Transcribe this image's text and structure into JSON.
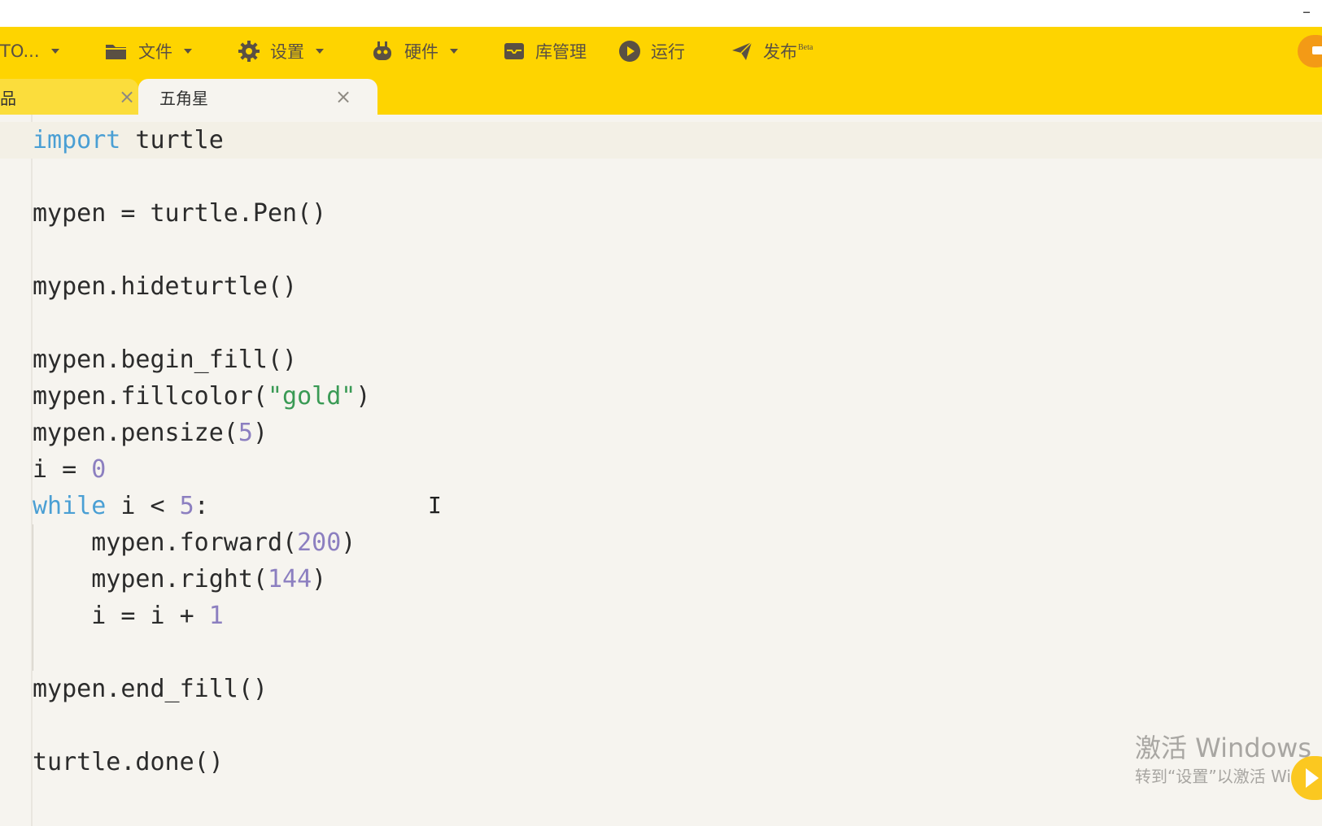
{
  "window": {
    "minimize_glyph": "–"
  },
  "toolbar": {
    "items": [
      {
        "label": "TO...",
        "icon": "none",
        "dropdown": true
      },
      {
        "label": "文件",
        "icon": "folder-icon",
        "dropdown": true
      },
      {
        "label": "设置",
        "icon": "gear-icon",
        "dropdown": true
      },
      {
        "label": "硬件",
        "icon": "robot-icon",
        "dropdown": true
      },
      {
        "label": "库管理",
        "icon": "inbox-icon",
        "dropdown": false
      },
      {
        "label": "运行",
        "icon": "play-icon",
        "dropdown": false
      },
      {
        "label": "发布",
        "badge": "Beta",
        "icon": "send-icon",
        "dropdown": false
      }
    ],
    "accent_color": "#fed400",
    "right_button_icon": "user-icon"
  },
  "tabs": [
    {
      "label": "品",
      "active": false,
      "close": "×"
    },
    {
      "label": "五角星",
      "active": true,
      "close": "×"
    }
  ],
  "editor": {
    "lines": [
      "import turtle",
      "",
      "mypen = turtle.Pen()",
      "",
      "mypen.hideturtle()",
      "",
      "mypen.begin_fill()",
      "mypen.fillcolor(\"gold\")",
      "mypen.pensize(5)",
      "i = 0",
      "while i < 5:",
      "    mypen.forward(200)",
      "    mypen.right(144)",
      "    i = i + 1",
      "",
      "mypen.end_fill()",
      "",
      "turtle.done()"
    ],
    "cursor_glyph": "I",
    "colors": {
      "keyword": "#4a9fd4",
      "string": "#3a9a55",
      "number": "#8c7fc0",
      "text": "#2b2b2b"
    }
  },
  "watermark": {
    "title": "激活 Windows",
    "subtitle": "转到“设置”以激活 Windows。"
  }
}
